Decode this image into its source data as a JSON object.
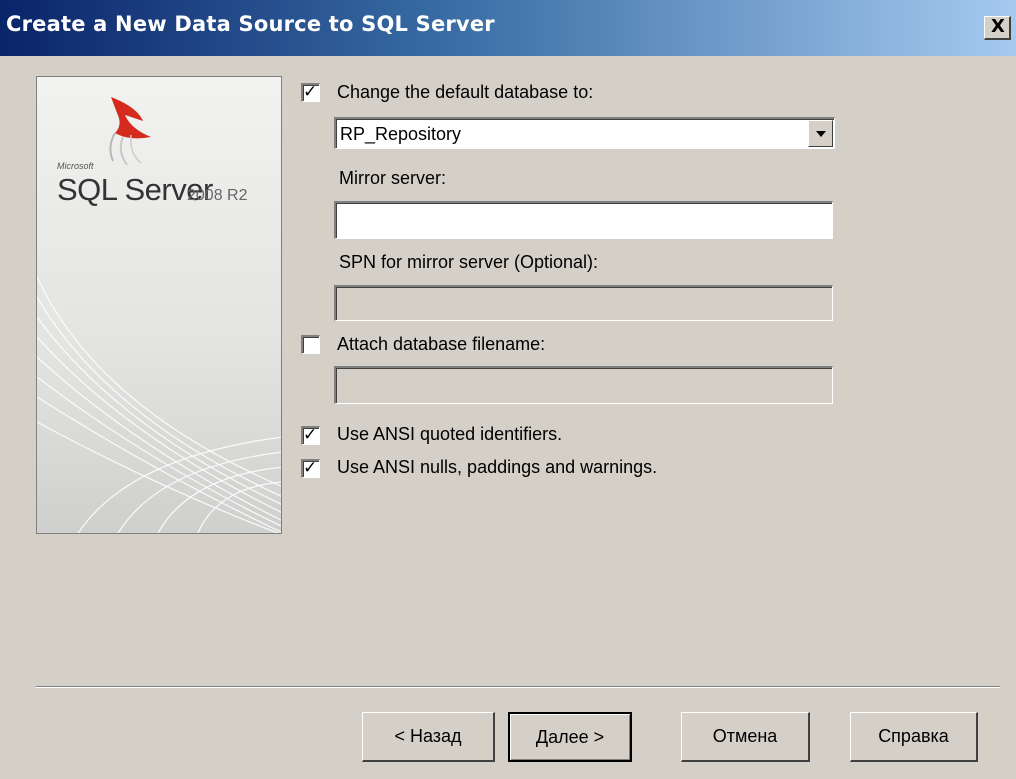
{
  "window": {
    "title": "Create a New Data Source to SQL Server",
    "close_label": "X"
  },
  "branding": {
    "microsoft": "Microsoft",
    "product": "SQL Server",
    "version": "2008 R2"
  },
  "form": {
    "change_default_db": {
      "label": "Change the default database to:",
      "checked": true,
      "value": "RP_Repository"
    },
    "mirror_server": {
      "label": "Mirror server:",
      "value": ""
    },
    "spn_mirror": {
      "label": "SPN for mirror server (Optional):",
      "value": ""
    },
    "attach_db": {
      "label": "Attach database filename:",
      "checked": false,
      "value": ""
    },
    "ansi_quoted": {
      "label": "Use ANSI quoted identifiers.",
      "checked": true
    },
    "ansi_nulls": {
      "label": "Use ANSI nulls, paddings and warnings.",
      "checked": true
    },
    "check_glyph": "✓"
  },
  "buttons": {
    "back": "< Назад",
    "next": "Далее >",
    "cancel": "Отмена",
    "help": "Справка"
  },
  "colors": {
    "face": "#d4d0c8",
    "title_start": "#0a246a",
    "title_end": "#a6caf0",
    "logo_red": "#d52b1e"
  }
}
